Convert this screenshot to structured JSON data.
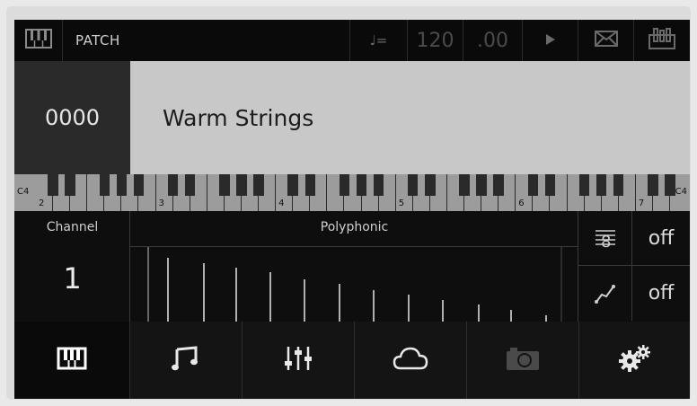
{
  "topbar": {
    "title": "PATCH",
    "tempo_icon": "♩=",
    "bpm": "120",
    "fraction": ".00",
    "icons": [
      "piano-icon",
      "metronome-icon",
      "play-icon",
      "mail-icon",
      "mixer-icon"
    ]
  },
  "patch": {
    "number": "0000",
    "name": "Warm Strings"
  },
  "keyboard": {
    "start_label": "C4",
    "end_label": "C4",
    "octave_labels": [
      "2",
      "3",
      "4",
      "5",
      "6",
      "7"
    ]
  },
  "channel": {
    "label": "Channel",
    "value": "1"
  },
  "mode": {
    "label": "Polyphonic"
  },
  "settings": [
    {
      "icon": "staff-icon",
      "value": "off"
    },
    {
      "icon": "curve-icon",
      "value": "off"
    }
  ],
  "tabs": [
    {
      "name": "keyboard-tab",
      "icon": "piano-icon",
      "active": true
    },
    {
      "name": "sequencer-tab",
      "icon": "music-note-icon"
    },
    {
      "name": "mixer-tab",
      "icon": "sliders-icon"
    },
    {
      "name": "cloud-tab",
      "icon": "cloud-icon"
    },
    {
      "name": "camera-tab",
      "icon": "camera-icon",
      "disabled": true
    },
    {
      "name": "settings-tab",
      "icon": "gears-icon"
    }
  ],
  "colors": {
    "background": "#0e0e0e",
    "patch_name_bg": "#c8c8c8",
    "patch_number_bg": "#2a2a2a",
    "keyboard_bg": "#9c9c9c"
  }
}
